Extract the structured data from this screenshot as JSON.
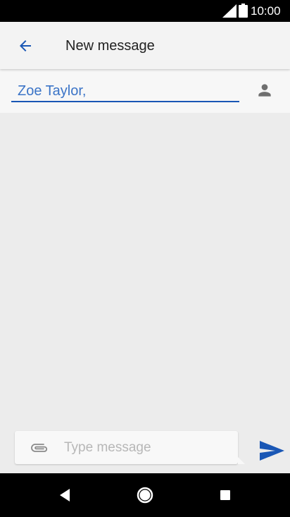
{
  "status_bar": {
    "time": "10:00",
    "icons": [
      "signal-icon",
      "battery-icon"
    ]
  },
  "app_bar": {
    "title": "New message",
    "back_icon": "arrow-back-icon"
  },
  "recipient": {
    "value": "Zoe Taylor,",
    "contact_icon": "person-icon"
  },
  "compose": {
    "placeholder": "Type message",
    "value": "",
    "attach_icon": "paperclip-icon",
    "send_icon": "send-icon"
  },
  "nav_bar": {
    "icons": [
      "nav-back-icon",
      "nav-home-icon",
      "nav-recents-icon"
    ]
  },
  "colors": {
    "accent": "#1a57b5",
    "recipient_text": "#3b74c7",
    "background": "#ececec",
    "app_bar": "#f3f3f3"
  }
}
